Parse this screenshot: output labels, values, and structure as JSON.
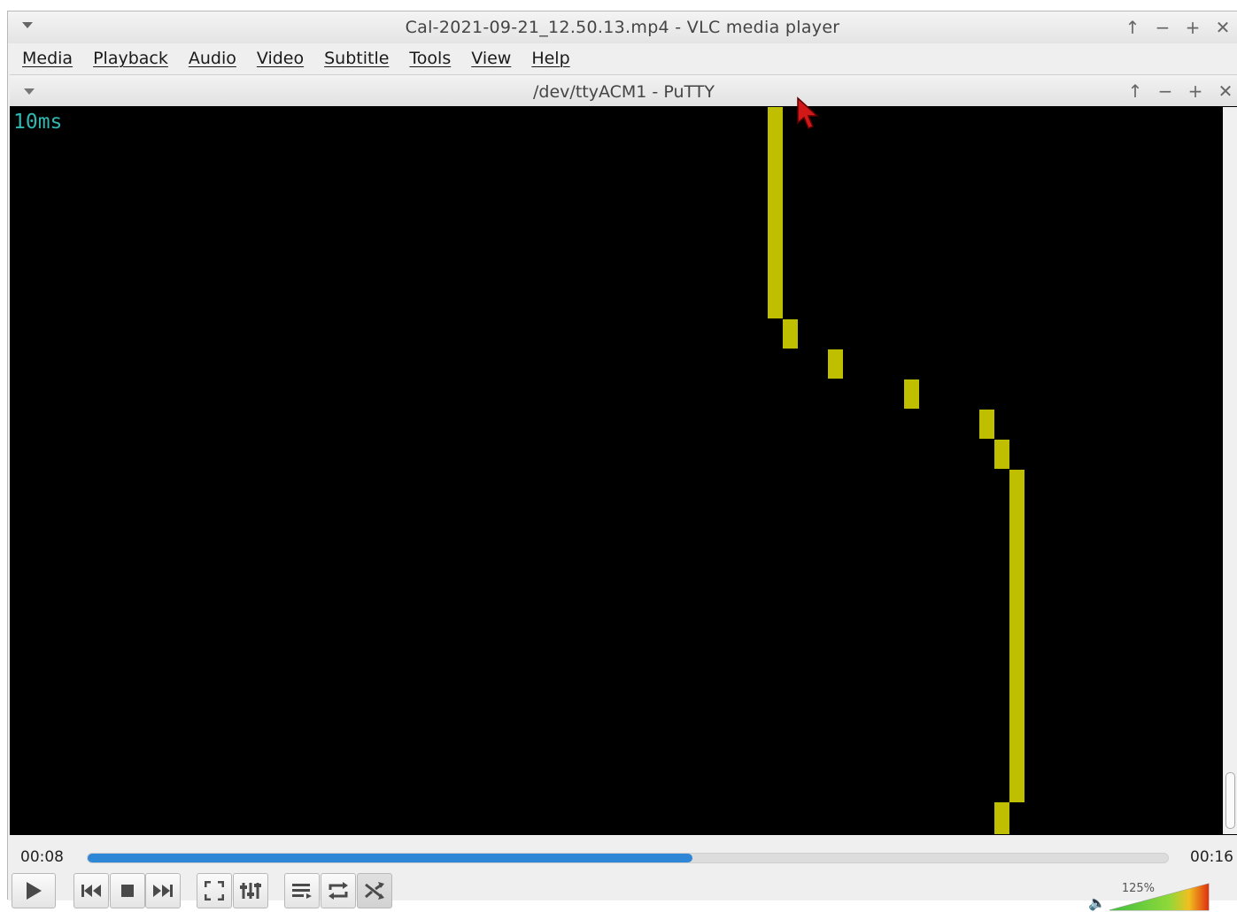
{
  "vlc": {
    "title": "Cal-2021-09-21_12.50.13.mp4 - VLC media player",
    "window_controls": [
      "↑",
      "−",
      "+",
      "✕"
    ],
    "menu": [
      "Media",
      "Playback",
      "Audio",
      "Video",
      "Subtitle",
      "Tools",
      "View",
      "Help"
    ]
  },
  "putty": {
    "title": "/dev/ttyACM1 - PuTTY",
    "window_controls": [
      "↑",
      "−",
      "+",
      "✕"
    ],
    "terminal_text": "10ms",
    "trace_color": "#bfbf00",
    "text_color": "#2fb8b0"
  },
  "player": {
    "elapsed": "00:08",
    "total": "00:16",
    "progress_fraction": 0.56,
    "volume_label": "125%",
    "accent": "#2e86d6",
    "buttons": [
      "play-icon",
      "previous-icon",
      "stop-icon",
      "next-icon",
      "fullscreen-icon",
      "extended-settings-icon",
      "playlist-icon",
      "loop-icon",
      "shuffle-icon"
    ]
  }
}
